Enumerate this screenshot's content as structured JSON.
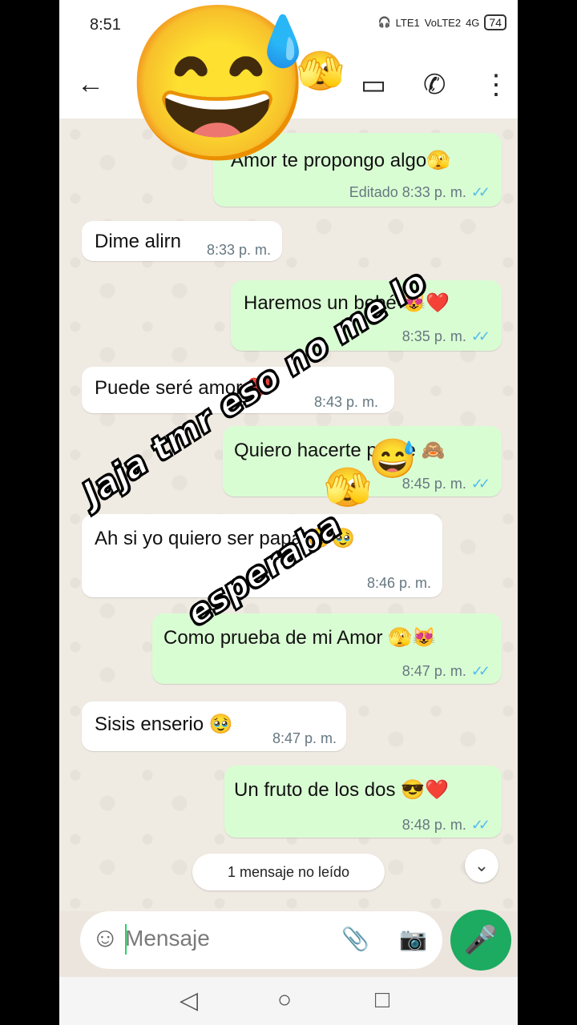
{
  "status": {
    "time": "8:51",
    "lte": "LTE1",
    "volte": "VoLTE2",
    "signal": "4G",
    "battery": "74"
  },
  "appbar": {
    "back": "←",
    "video": "▭",
    "call": "✆",
    "menu": "⋮"
  },
  "messages": [
    {
      "dir": "out",
      "text": "Amor te propongo algo🫣",
      "time": "Editado 8:33 p. m.",
      "ticks": "✓✓"
    },
    {
      "dir": "in",
      "text": "Dime alirn",
      "time": "8:33 p. m."
    },
    {
      "dir": "out",
      "text": "Haremos un bebé 😻❤️",
      "time": "8:35 p. m.",
      "ticks": "✓✓"
    },
    {
      "dir": "in",
      "text": "Puede seré amor ❤️",
      "time": "8:43 p. m."
    },
    {
      "dir": "out",
      "text": "Quiero hacerte padre 🙈",
      "time": "8:45 p. m.",
      "ticks": "✓✓"
    },
    {
      "dir": "in",
      "text": "Ah si yo quiero ser papá 🥹🥹",
      "time": "8:46 p. m."
    },
    {
      "dir": "out",
      "text": "Como prueba de mi Amor 🫣😻",
      "time": "8:47 p. m.",
      "ticks": "✓✓"
    },
    {
      "dir": "in",
      "text": "Sisis enserio 🥹",
      "time": "8:47 p. m."
    },
    {
      "dir": "out",
      "text": "Un fruto de los dos 😎❤️",
      "time": "8:48 p. m.",
      "ticks": "✓✓"
    }
  ],
  "unread_label": "1 mensaje no leído",
  "input": {
    "placeholder": "Mensaje"
  },
  "overlay": {
    "line1": "Jaja tmr eso no me lo",
    "line2": "esperaba"
  },
  "stickers": {
    "big": "😅",
    "small1": "🫣",
    "small2": "😅",
    "small3": "🫣"
  },
  "icons": {
    "sticker": "☺",
    "attach": "📎",
    "camera": "📷",
    "mic": "🎤",
    "scroll_down": "⌄",
    "nav_back": "◁",
    "nav_home": "○",
    "nav_recent": "□"
  }
}
